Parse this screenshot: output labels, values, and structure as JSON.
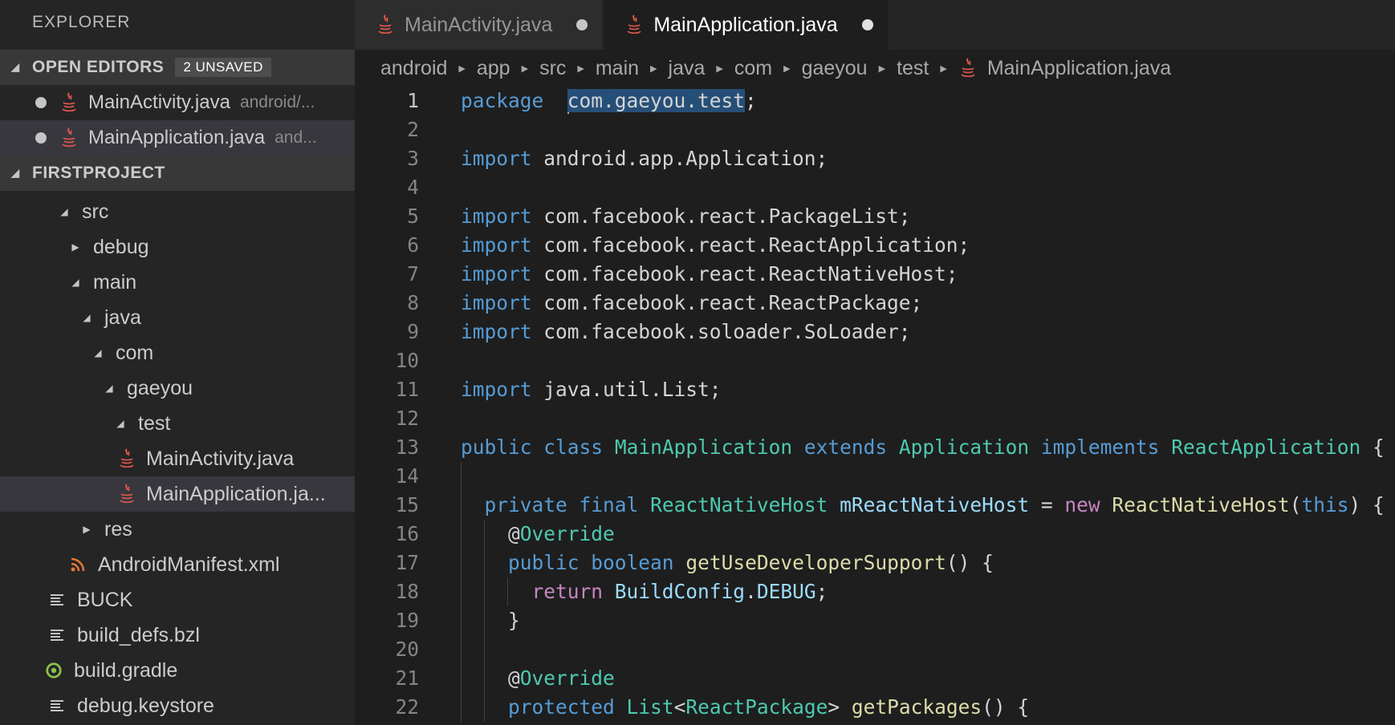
{
  "sidebar": {
    "title": "EXPLORER",
    "open_editors": {
      "label": "OPEN EDITORS",
      "badge": "2 UNSAVED",
      "items": [
        {
          "name": "MainActivity.java",
          "desc": "android/..."
        },
        {
          "name": "MainApplication.java",
          "desc": "and..."
        }
      ]
    },
    "project": {
      "label": "FIRSTPROJECT",
      "tree": [
        {
          "label": "src",
          "twisty": "open",
          "icon": "none"
        },
        {
          "label": "debug",
          "twisty": "closed",
          "icon": "none"
        },
        {
          "label": "main",
          "twisty": "open",
          "icon": "none"
        },
        {
          "label": "java",
          "twisty": "open",
          "icon": "none"
        },
        {
          "label": "com",
          "twisty": "open",
          "icon": "none"
        },
        {
          "label": "gaeyou",
          "twisty": "open",
          "icon": "none"
        },
        {
          "label": "test",
          "twisty": "open",
          "icon": "none"
        },
        {
          "label": "MainActivity.java",
          "twisty": "",
          "icon": "java-icon"
        },
        {
          "label": "MainApplication.ja...",
          "twisty": "",
          "icon": "java-icon"
        },
        {
          "label": "res",
          "twisty": "closed",
          "icon": "none"
        },
        {
          "label": "AndroidManifest.xml",
          "twisty": "",
          "icon": "rss-icon"
        },
        {
          "label": "BUCK",
          "twisty": "",
          "icon": "lines-icon"
        },
        {
          "label": "build_defs.bzl",
          "twisty": "",
          "icon": "lines-icon"
        },
        {
          "label": "build.gradle",
          "twisty": "",
          "icon": "gradle-icon"
        },
        {
          "label": "debug.keystore",
          "twisty": "",
          "icon": "lines-icon"
        }
      ]
    }
  },
  "tabs": [
    {
      "label": "MainActivity.java",
      "active": false,
      "unsaved": true
    },
    {
      "label": "MainApplication.java",
      "active": true,
      "unsaved": true
    }
  ],
  "breadcrumb": [
    "android",
    "app",
    "src",
    "main",
    "java",
    "com",
    "gaeyou",
    "test",
    "MainApplication.java"
  ],
  "editor": {
    "lines": [
      [
        [
          "kw",
          "package"
        ],
        [
          "",
          "  "
        ],
        [
          "sel",
          "com.gaeyou.test"
        ],
        [
          "",
          ";"
        ]
      ],
      [],
      [
        [
          "kw",
          "import"
        ],
        [
          "",
          " android.app.Application;"
        ]
      ],
      [],
      [
        [
          "kw",
          "import"
        ],
        [
          "",
          " com.facebook.react.PackageList;"
        ]
      ],
      [
        [
          "kw",
          "import"
        ],
        [
          "",
          " com.facebook.react.ReactApplication;"
        ]
      ],
      [
        [
          "kw",
          "import"
        ],
        [
          "",
          " com.facebook.react.ReactNativeHost;"
        ]
      ],
      [
        [
          "kw",
          "import"
        ],
        [
          "",
          " com.facebook.react.ReactPackage;"
        ]
      ],
      [
        [
          "kw",
          "import"
        ],
        [
          "",
          " com.facebook.soloader.SoLoader;"
        ]
      ],
      [],
      [
        [
          "kw",
          "import"
        ],
        [
          "",
          " java.util.List;"
        ]
      ],
      [],
      [
        [
          "kw",
          "public"
        ],
        [
          "",
          " "
        ],
        [
          "kw",
          "class"
        ],
        [
          "",
          " "
        ],
        [
          "ty",
          "MainApplication"
        ],
        [
          "",
          " "
        ],
        [
          "kw",
          "extends"
        ],
        [
          "",
          " "
        ],
        [
          "ty",
          "Application"
        ],
        [
          "",
          " "
        ],
        [
          "kw",
          "implements"
        ],
        [
          "",
          " "
        ],
        [
          "ty",
          "ReactApplication"
        ],
        [
          "",
          " {"
        ]
      ],
      [],
      [
        [
          "",
          "  "
        ],
        [
          "kw",
          "private"
        ],
        [
          "",
          " "
        ],
        [
          "kw",
          "final"
        ],
        [
          "",
          " "
        ],
        [
          "ty",
          "ReactNativeHost"
        ],
        [
          "",
          " "
        ],
        [
          "var",
          "mReactNativeHost"
        ],
        [
          "",
          " = "
        ],
        [
          "kw2",
          "new"
        ],
        [
          "",
          " "
        ],
        [
          "fn",
          "ReactNativeHost"
        ],
        [
          "",
          "("
        ],
        [
          "kw",
          "this"
        ],
        [
          "",
          ") {"
        ]
      ],
      [
        [
          "",
          "    @"
        ],
        [
          "ty",
          "Override"
        ]
      ],
      [
        [
          "",
          "    "
        ],
        [
          "kw",
          "public"
        ],
        [
          "",
          " "
        ],
        [
          "kw",
          "boolean"
        ],
        [
          "",
          " "
        ],
        [
          "fn",
          "getUseDeveloperSupport"
        ],
        [
          "",
          "() {"
        ]
      ],
      [
        [
          "",
          "      "
        ],
        [
          "kw2",
          "return"
        ],
        [
          "",
          " "
        ],
        [
          "var",
          "BuildConfig"
        ],
        [
          "",
          "."
        ],
        [
          "var",
          "DEBUG"
        ],
        [
          "",
          ";"
        ]
      ],
      [
        [
          "",
          "    }"
        ]
      ],
      [],
      [
        [
          "",
          "    @"
        ],
        [
          "ty",
          "Override"
        ]
      ],
      [
        [
          "",
          "    "
        ],
        [
          "kw",
          "protected"
        ],
        [
          "",
          " "
        ],
        [
          "ty",
          "List"
        ],
        [
          "",
          "<"
        ],
        [
          "ty",
          "ReactPackage"
        ],
        [
          "",
          "> "
        ],
        [
          "fn",
          "getPackages"
        ],
        [
          "",
          "() {"
        ]
      ]
    ]
  }
}
